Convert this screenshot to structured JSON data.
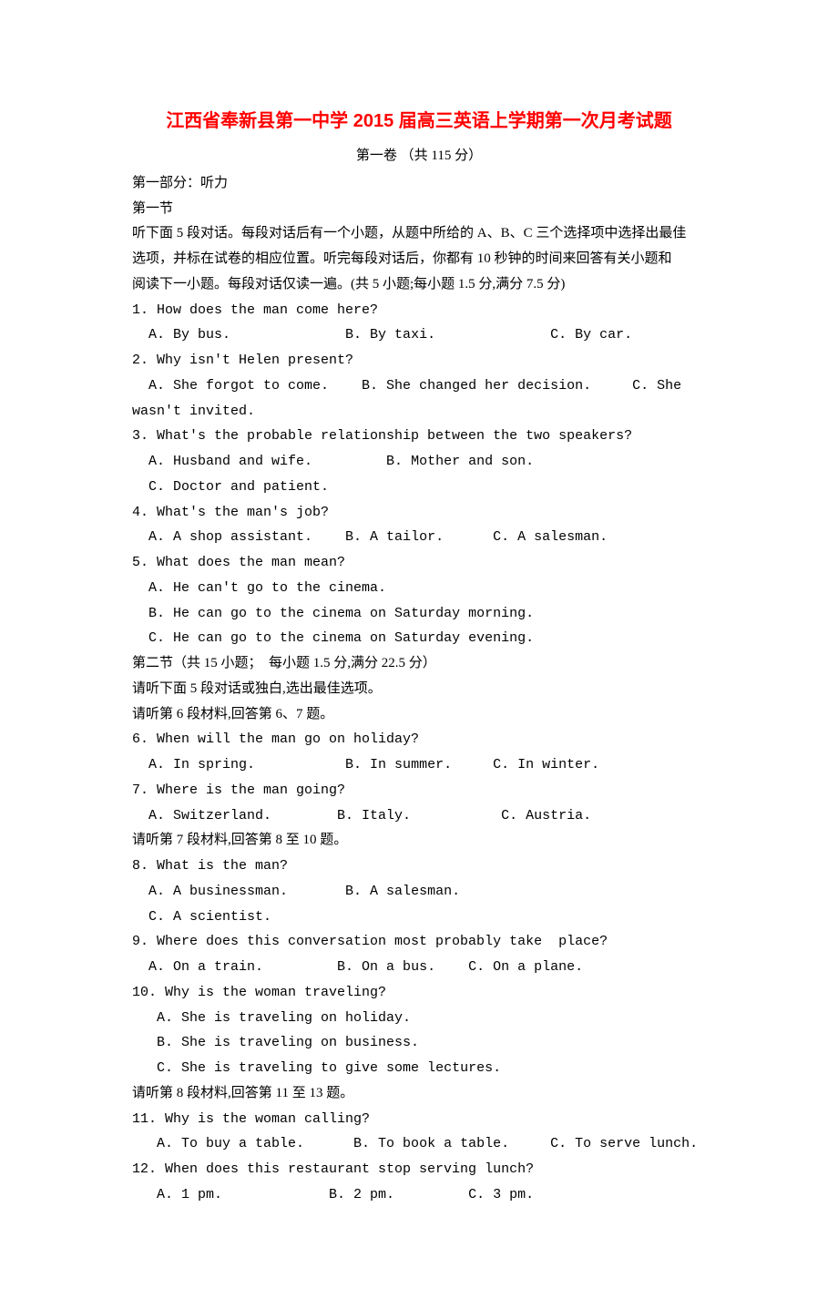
{
  "title": "江西省奉新县第一中学 2015 届高三英语上学期第一次月考试题",
  "subtitle": "第一卷 （共 115 分）",
  "part1_heading": "第一部分：听力",
  "section1_heading": "第一节",
  "section1_instructions_l1": "听下面 5 段对话。每段对话后有一个小题，从题中所给的 A、B、C 三个选择项中选择出最佳",
  "section1_instructions_l2": "选项，并标在试卷的相应位置。听完每段对话后，你都有 10 秒钟的时间来回答有关小题和",
  "section1_instructions_l3": "阅读下一小题。每段对话仅读一遍。(共 5 小题;每小题 1.5 分,满分 7.5 分)",
  "q1": "1. How does the man come here?",
  "q1_opts": "  A. By bus.              B. By taxi.              C. By car.",
  "q2": "2. Why isn't Helen present?",
  "q2_opts": "  A. She forgot to come.    B. She changed her decision.     C. She wasn't invited.",
  "q3": "3. What's the probable relationship between the two speakers?",
  "q3_opts_ab": "  A. Husband and wife.         B. Mother and son.",
  "q3_opts_c": "  C. Doctor and patient.",
  "q4": "4. What's the man's job?",
  "q4_opts": "  A. A shop assistant.    B. A tailor.      C. A salesman.",
  "q5": "5. What does the man mean?",
  "q5_opt_a": "  A. He can't go to the cinema.",
  "q5_opt_b": "  B. He can go to the cinema on Saturday morning.",
  "q5_opt_c": "  C. He can go to the cinema on Saturday evening.",
  "section2_heading": "第二节（共 15 小题；  每小题 1.5 分,满分 22.5 分）",
  "section2_instr": "请听下面 5 段对话或独白,选出最佳选项。",
  "mat6": "请听第 6 段材料,回答第 6、7 题。",
  "q6": "6. When will the man go on holiday?",
  "q6_opts": "  A. In spring.           B. In summer.     C. In winter.",
  "q7": "7. Where is the man going?",
  "q7_opts": "  A. Switzerland.        B. Italy.           C. Austria.",
  "mat7": "请听第 7 段材料,回答第 8 至 10 题。",
  "q8": "8. What is the man?",
  "q8_opts_ab": "  A. A businessman.       B. A salesman.",
  "q8_opts_c": "  C. A scientist.",
  "q9": "9. Where does this conversation most probably take  place?",
  "q9_opts": "  A. On a train.         B. On a bus.    C. On a plane.",
  "q10": "10. Why is the woman traveling?",
  "q10_opt_a": "   A. She is traveling on holiday.",
  "q10_opt_b": "   B. She is traveling on business.",
  "q10_opt_c": "   C. She is traveling to give some lectures.",
  "mat8": "请听第 8 段材料,回答第 11 至 13 题。",
  "q11": "11. Why is the woman calling?",
  "q11_opts": "   A. To buy a table.      B. To book a table.     C. To serve lunch.",
  "q12": "12. When does this restaurant stop serving lunch?",
  "q12_opts": "   A. 1 pm.             B. 2 pm.         C. 3 pm."
}
